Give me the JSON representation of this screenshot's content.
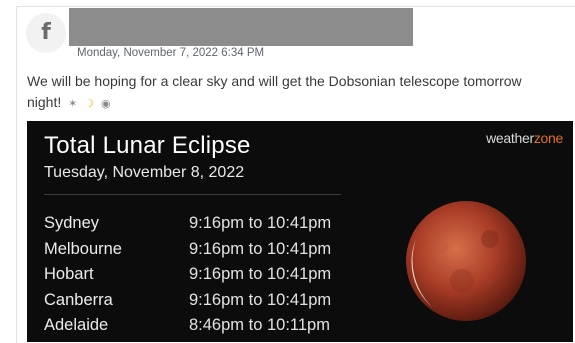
{
  "post": {
    "platform_icon": "facebook-icon",
    "timestamp": "Monday, November 7, 2022 6:34 PM",
    "text_line1": "We will be hoping for a clear sky and will get the Dobsonian telescope tomorrow",
    "text_line2": "night!",
    "emojis": [
      "telescope-icon",
      "crescent-moon-icon",
      "eye-icon"
    ]
  },
  "graphic": {
    "title": "Total Lunar Eclipse",
    "date": "Tuesday, November 8, 2022",
    "brand_main": "weather",
    "brand_accent": "zone",
    "rows": [
      {
        "city": "Sydney",
        "time": "9:16pm to 10:41pm"
      },
      {
        "city": "Melbourne",
        "time": "9:16pm to 10:41pm"
      },
      {
        "city": "Hobart",
        "time": "9:16pm to 10:41pm"
      },
      {
        "city": "Canberra",
        "time": "9:16pm to 10:41pm"
      },
      {
        "city": "Adelaide",
        "time": "8:46pm to 10:11pm"
      }
    ],
    "colors": {
      "background": "#0c0c0c",
      "moon": "#b0402a",
      "brand_accent": "#e07020"
    }
  }
}
